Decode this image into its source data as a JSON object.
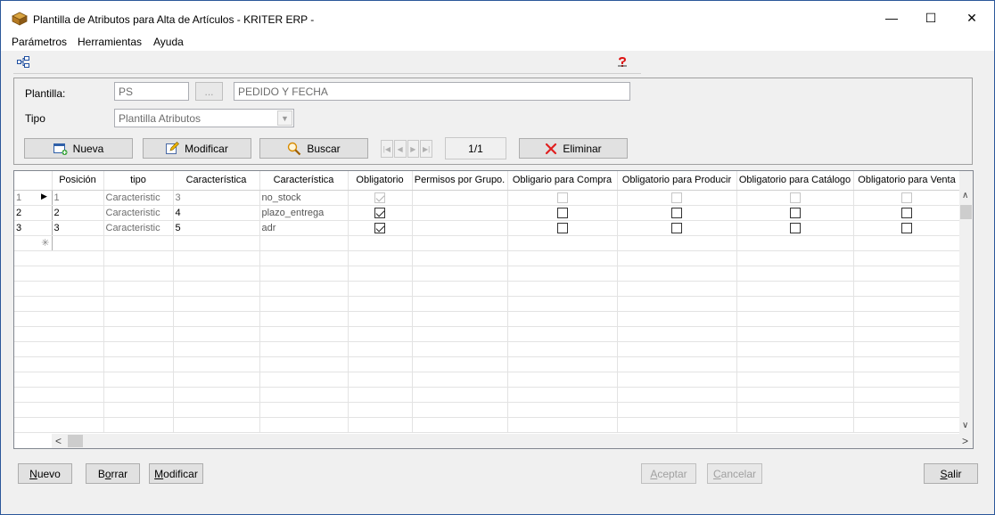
{
  "window": {
    "title": "Plantilla de Atributos para Alta de Artículos - KRITER ERP -",
    "minimize": "—",
    "maximize": "☐",
    "close": "✕"
  },
  "menu": [
    "Parámetros",
    "Herramientas",
    "Ayuda"
  ],
  "form": {
    "plantilla_label": "Plantilla:",
    "plantilla_code": "PS",
    "browse_label": "...",
    "plantilla_desc": "PEDIDO Y FECHA",
    "tipo_label": "Tipo",
    "tipo_value": "Plantilla Atributos"
  },
  "actions": {
    "nueva": "Nueva",
    "modificar": "Modificar",
    "buscar": "Buscar",
    "record_counter": "1/1",
    "eliminar": "Eliminar"
  },
  "grid": {
    "columns": [
      "Posición",
      "tipo",
      "Característica",
      "Característica",
      "Obligatorio",
      "Permisos por Grupo.",
      "Obligario para Compra",
      "Obligatorio para Producir",
      "Obligatorio para Catálogo",
      "Obligatorio para Venta"
    ],
    "rows": [
      {
        "num": "1",
        "pos": "1",
        "tipo": "Caracteristic",
        "car_id": "3",
        "car_name": "no_stock",
        "obligatorio": true,
        "compra": false,
        "producir": false,
        "catalogo": false,
        "venta": false,
        "disabled": true
      },
      {
        "num": "2",
        "pos": "2",
        "tipo": "Caracteristic",
        "car_id": "4",
        "car_name": "plazo_entrega",
        "obligatorio": true,
        "compra": false,
        "producir": false,
        "catalogo": false,
        "venta": false,
        "disabled": false
      },
      {
        "num": "3",
        "pos": "3",
        "tipo": "Caracteristic",
        "car_id": "5",
        "car_name": "adr",
        "obligatorio": true,
        "compra": false,
        "producir": false,
        "catalogo": false,
        "venta": false,
        "disabled": false
      }
    ],
    "new_row_marker": "✳"
  },
  "bottom": {
    "nuevo_pre": "",
    "nuevo_u": "N",
    "nuevo_post": "uevo",
    "borrar_pre": "B",
    "borrar_u": "o",
    "borrar_post": "rrar",
    "modificar_pre": "",
    "modificar_u": "M",
    "modificar_post": "odificar",
    "aceptar_pre": "",
    "aceptar_u": "A",
    "aceptar_post": "ceptar",
    "cancelar_pre": "",
    "cancelar_u": "C",
    "cancelar_post": "ancelar",
    "salir_pre": "",
    "salir_u": "S",
    "salir_post": "alir"
  }
}
